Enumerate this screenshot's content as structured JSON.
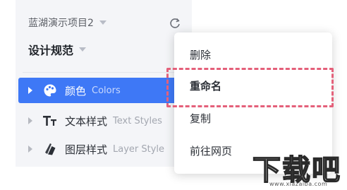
{
  "sidebar": {
    "project": {
      "label": "蓝湖演示项目2",
      "icon": "chevron-down-icon"
    },
    "refresh_icon": "refresh-icon",
    "page": {
      "label": "设计规范",
      "icon": "chevron-down-icon"
    },
    "items": [
      {
        "cn": "颜色",
        "en": "Colors",
        "icon": "palette-icon",
        "active": true
      },
      {
        "cn": "文本样式",
        "en": "Text Styles",
        "icon": "text-style-icon",
        "active": false
      },
      {
        "cn": "图层样式",
        "en": "Layer Style",
        "icon": "layer-style-icon",
        "active": false
      }
    ],
    "accent_color": "#3e78f6"
  },
  "context_menu": {
    "items": [
      {
        "label": "删除"
      },
      {
        "label": "重命名",
        "highlighted": true
      },
      {
        "label": "复制"
      },
      {
        "label": "前往网页"
      }
    ],
    "highlight_color": "#e4607a"
  },
  "watermark": {
    "text": "下载吧",
    "url": "www.xiazaiba.com"
  }
}
